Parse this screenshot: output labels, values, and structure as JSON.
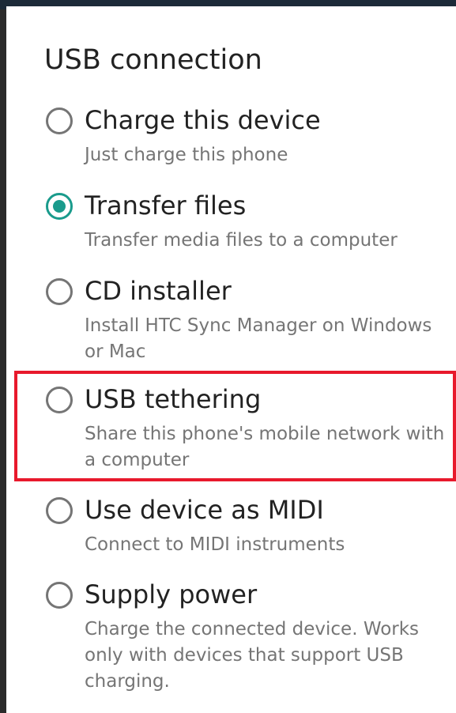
{
  "dialog": {
    "title": "USB connection",
    "options": [
      {
        "label": "Charge this device",
        "description": "Just charge this phone",
        "selected": false
      },
      {
        "label": "Transfer files",
        "description": "Transfer media files to a computer",
        "selected": true
      },
      {
        "label": "CD installer",
        "description": "Install HTC Sync Manager on Windows or Mac",
        "selected": false
      },
      {
        "label": "USB tethering",
        "description": "Share this phone's mobile network with a computer",
        "selected": false
      },
      {
        "label": "Use device as MIDI",
        "description": "Connect to MIDI instruments",
        "selected": false
      },
      {
        "label": "Supply power",
        "description": "Charge the connected device. Works only with devices that support USB charging.",
        "selected": false
      }
    ]
  },
  "colors": {
    "accent": "#1a9b8c",
    "highlight": "#e8192c",
    "primary_text": "#222222",
    "secondary_text": "#757575"
  }
}
